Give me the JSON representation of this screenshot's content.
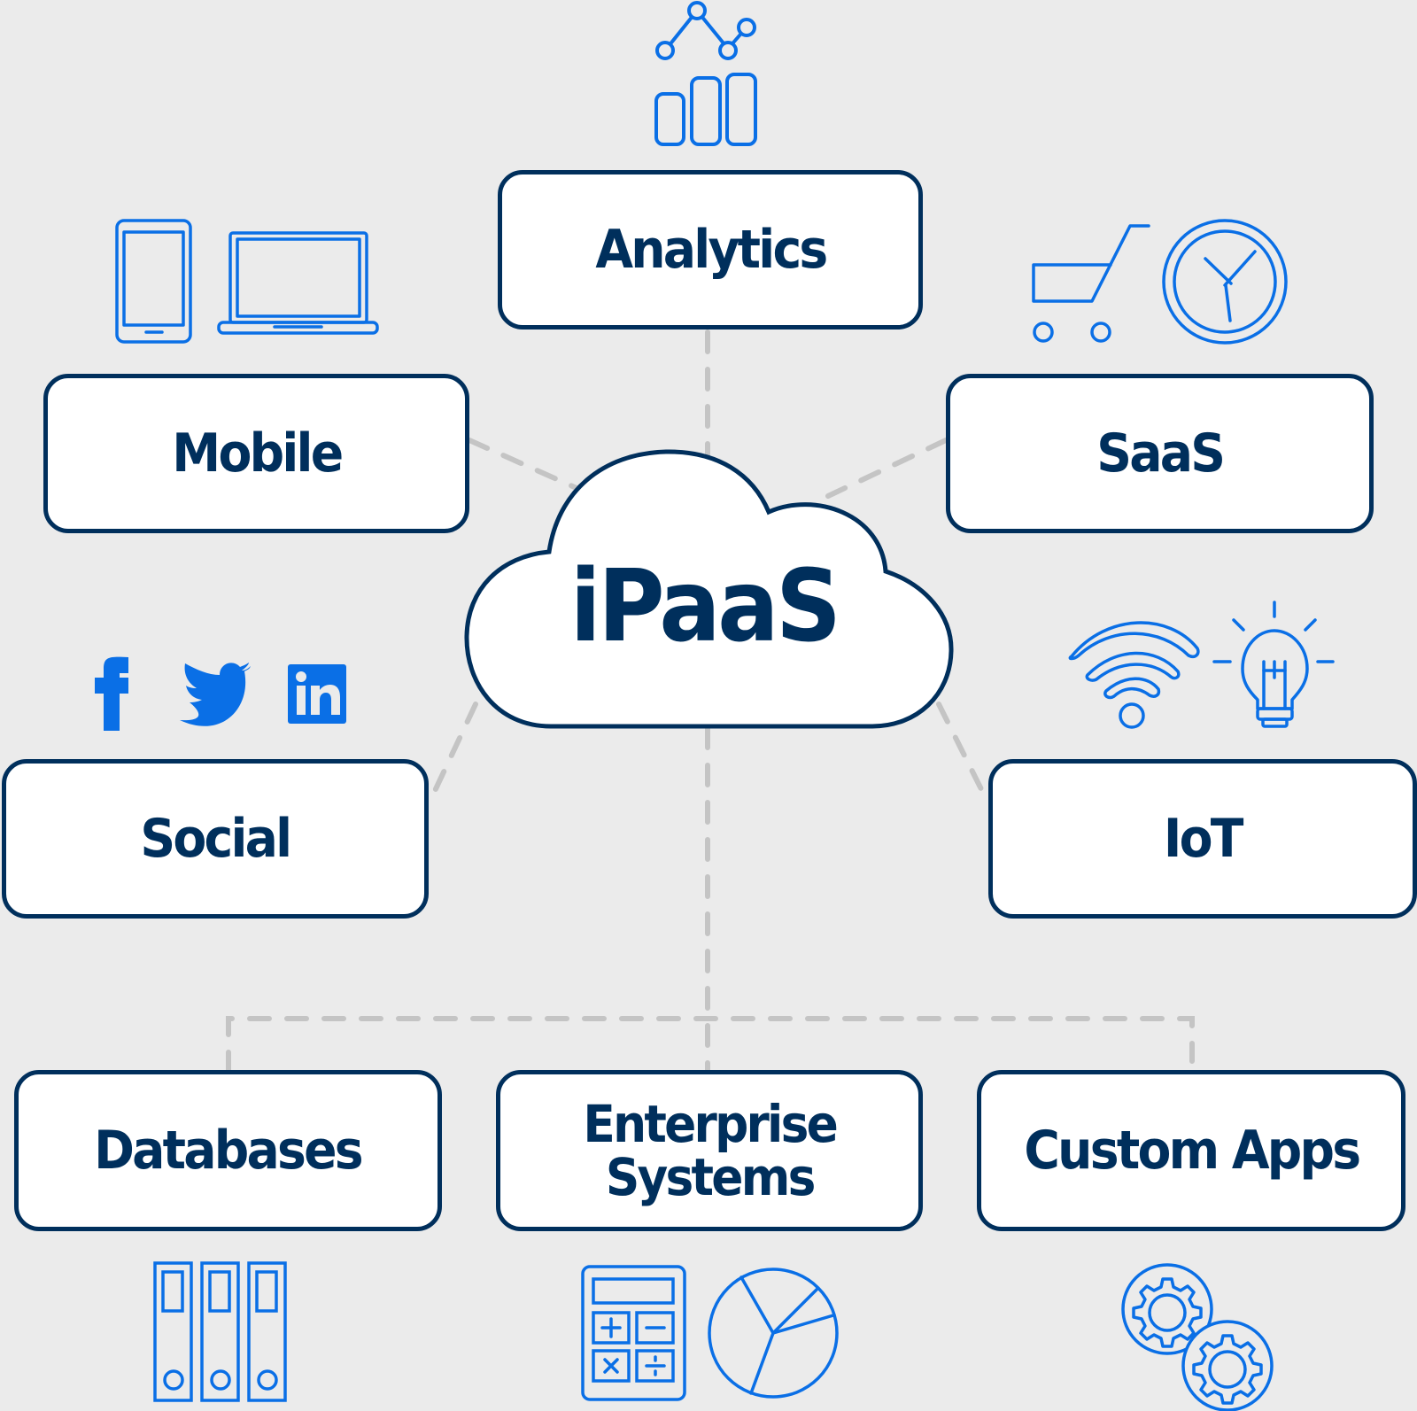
{
  "diagram": {
    "center": {
      "label": "iPaaS",
      "shape": "cloud"
    },
    "nodes": [
      {
        "id": "analytics",
        "label": "Analytics",
        "icons": [
          "line-chart-icon",
          "bar-chart-icon"
        ]
      },
      {
        "id": "mobile",
        "label": "Mobile",
        "icons": [
          "smartphone-icon",
          "laptop-icon"
        ]
      },
      {
        "id": "saas",
        "label": "SaaS",
        "icons": [
          "shopping-cart-icon",
          "clock-icon"
        ]
      },
      {
        "id": "social",
        "label": "Social",
        "icons": [
          "facebook-icon",
          "twitter-icon",
          "linkedin-icon"
        ]
      },
      {
        "id": "iot",
        "label": "IoT",
        "icons": [
          "wifi-icon",
          "lightbulb-icon"
        ]
      },
      {
        "id": "databases",
        "label": "Databases",
        "icons": [
          "binders-icon"
        ]
      },
      {
        "id": "enterprise",
        "label": "Enterprise\nSystems",
        "icons": [
          "calculator-icon",
          "pie-chart-icon"
        ]
      },
      {
        "id": "custom-apps",
        "label": "Custom Apps",
        "icons": [
          "gears-icon"
        ]
      }
    ],
    "edges": [
      {
        "from": "iPaaS",
        "to": "analytics",
        "style": "dashed"
      },
      {
        "from": "iPaaS",
        "to": "mobile",
        "style": "dashed"
      },
      {
        "from": "iPaaS",
        "to": "saas",
        "style": "dashed"
      },
      {
        "from": "iPaaS",
        "to": "social",
        "style": "dashed"
      },
      {
        "from": "iPaaS",
        "to": "iot",
        "style": "dashed"
      },
      {
        "from": "iPaaS",
        "to": "databases",
        "style": "dashed"
      },
      {
        "from": "iPaaS",
        "to": "enterprise",
        "style": "dashed"
      },
      {
        "from": "iPaaS",
        "to": "custom-apps",
        "style": "dashed"
      }
    ],
    "colors": {
      "background": "#ebebeb",
      "node_border": "#002f5c",
      "node_text": "#002f5c",
      "node_fill": "#ffffff",
      "icon_blue": "#0a6fe6",
      "connector_gray": "#c4c4c4"
    }
  }
}
